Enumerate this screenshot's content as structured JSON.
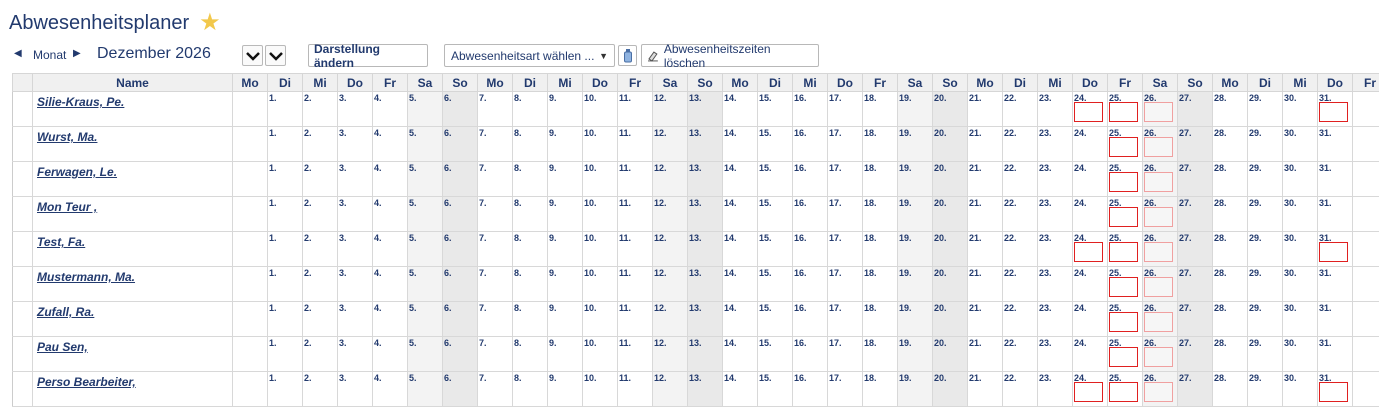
{
  "page": {
    "title": "Abwesenheitsplaner"
  },
  "toolbar": {
    "month_label": "Monat",
    "current_date": "Dezember 2026",
    "change_view_label": "Darstellung ändern",
    "absence_select": {
      "selected": "Abwesenheitsart wählen ..."
    },
    "delete_label": "Abwesenheitszeiten löschen"
  },
  "grid": {
    "name_header": "Name",
    "day_headers": [
      "Mo",
      "Di",
      "Mi",
      "Do",
      "Fr",
      "Sa",
      "So",
      "Mo",
      "Di",
      "Mi",
      "Do",
      "Fr",
      "Sa",
      "So",
      "Mo",
      "Di",
      "Mi",
      "Do",
      "Fr",
      "Sa",
      "So",
      "Mo",
      "Di",
      "Mi",
      "Do",
      "Fr",
      "Sa",
      "So",
      "Mo",
      "Di",
      "Mi",
      "Do",
      "Fr"
    ],
    "days": [
      "",
      "1.",
      "2.",
      "3.",
      "4.",
      "5.",
      "6.",
      "7.",
      "8.",
      "9.",
      "10.",
      "11.",
      "12.",
      "13.",
      "14.",
      "15.",
      "16.",
      "17.",
      "18.",
      "19.",
      "20.",
      "21.",
      "22.",
      "23.",
      "24.",
      "25.",
      "26.",
      "27.",
      "28.",
      "29.",
      "30.",
      "31.",
      ""
    ],
    "rows": [
      {
        "name": "Silie-Kraus, Pe.",
        "marked_days": [
          "24.",
          "25.",
          "26.",
          "31."
        ]
      },
      {
        "name": "Wurst, Ma.",
        "marked_days": [
          "25.",
          "26."
        ]
      },
      {
        "name": "Ferwagen, Le.",
        "marked_days": [
          "25.",
          "26."
        ]
      },
      {
        "name": "Mon Teur ,",
        "marked_days": [
          "25.",
          "26."
        ]
      },
      {
        "name": "Test, Fa.",
        "marked_days": [
          "24.",
          "25.",
          "26.",
          "31."
        ]
      },
      {
        "name": "Mustermann, Ma.",
        "marked_days": [
          "25.",
          "26."
        ]
      },
      {
        "name": "Zufall, Ra.",
        "marked_days": [
          "25.",
          "26."
        ]
      },
      {
        "name": "Pau Sen,",
        "marked_days": [
          "25.",
          "26."
        ]
      },
      {
        "name": "Perso Bearbeiter,",
        "marked_days": [
          "24.",
          "25.",
          "26.",
          "31."
        ]
      }
    ]
  },
  "colors": {
    "accent": "#223a6e",
    "star": "#f2c84b",
    "absence_border": "#e02020"
  }
}
